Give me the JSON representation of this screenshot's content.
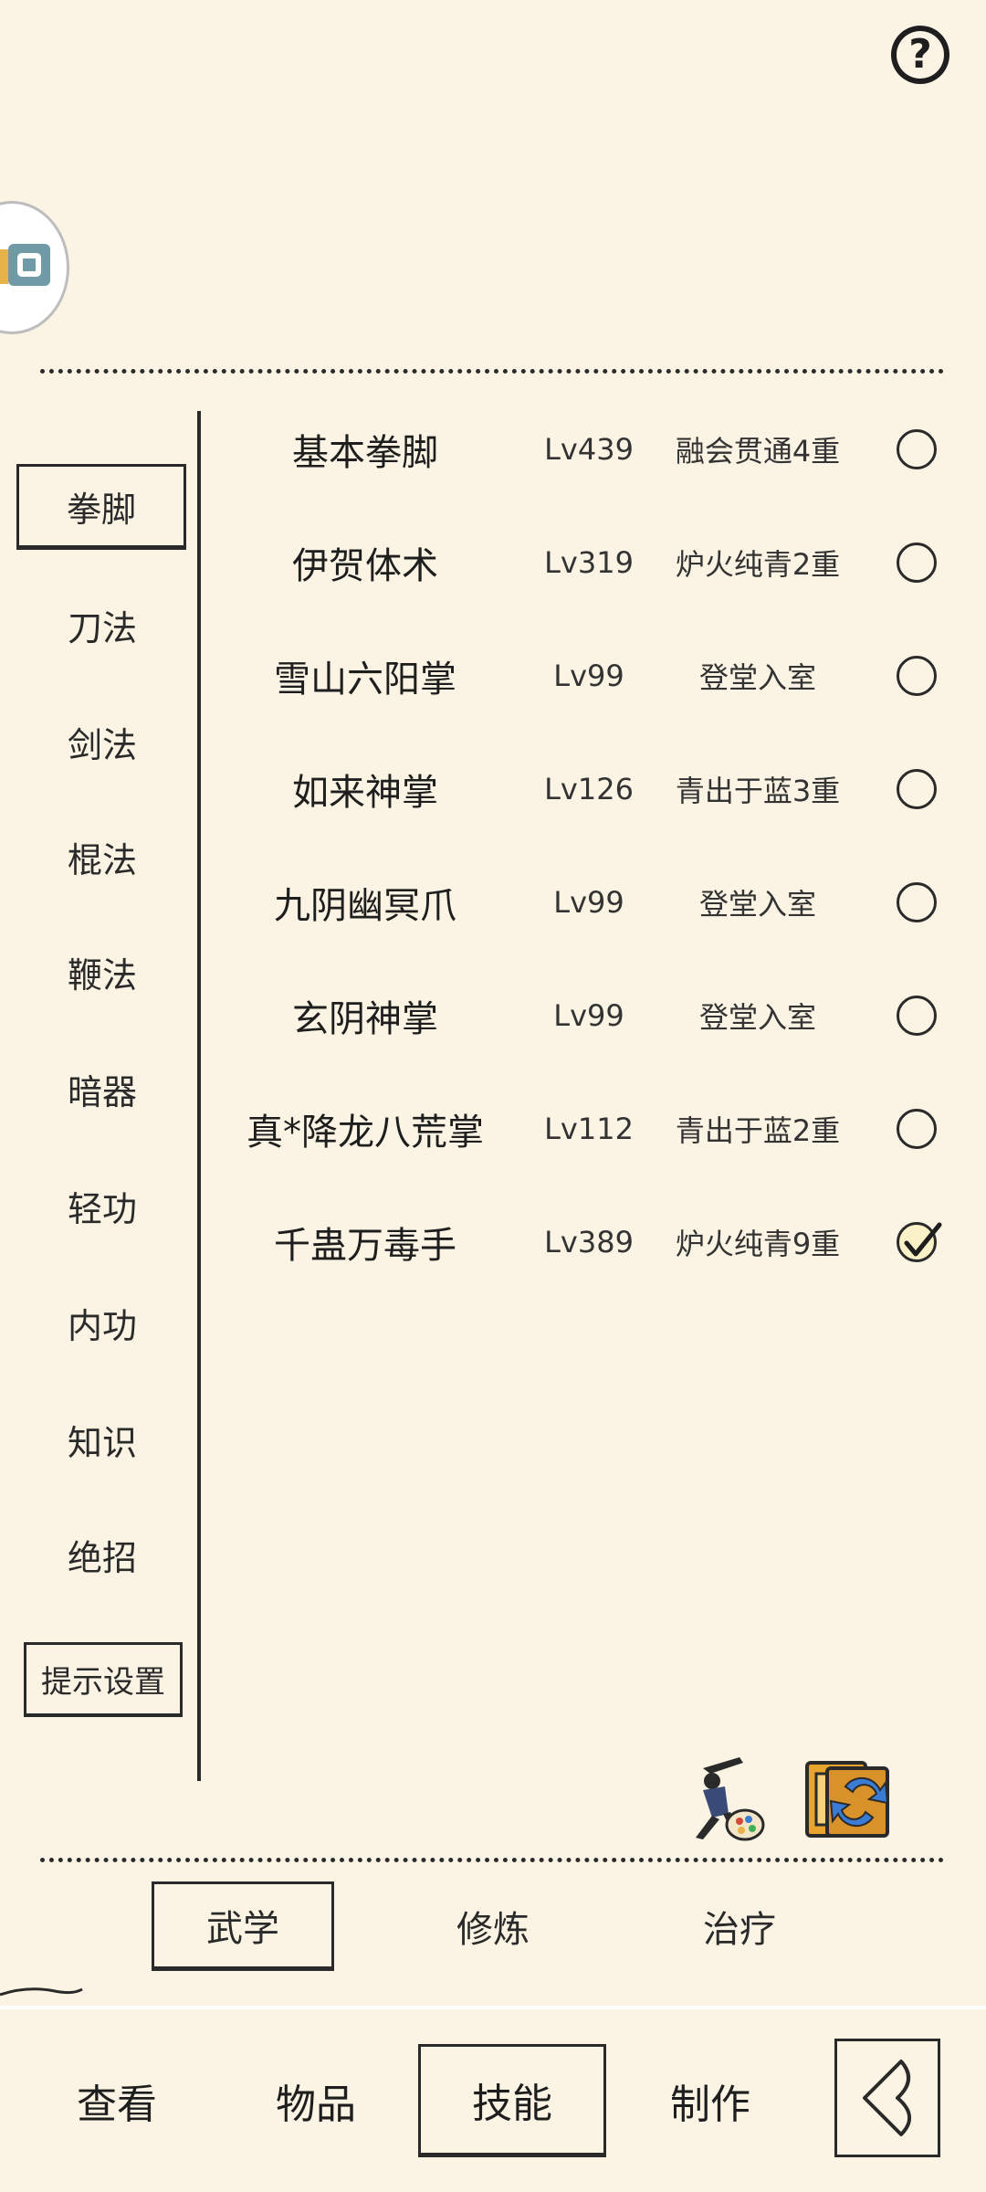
{
  "header": {
    "help_icon": "help-icon",
    "help_glyph": "?"
  },
  "categories": [
    {
      "label": "拳脚",
      "selected": true
    },
    {
      "label": "刀法"
    },
    {
      "label": "剑法"
    },
    {
      "label": "棍法"
    },
    {
      "label": "鞭法"
    },
    {
      "label": "暗器"
    },
    {
      "label": "轻功"
    },
    {
      "label": "内功"
    },
    {
      "label": "知识"
    },
    {
      "label": "绝招"
    }
  ],
  "hint_button": "提示设置",
  "skills": [
    {
      "name": "基本拳脚",
      "level": "Lv439",
      "state": "融会贯通4重",
      "checked": false
    },
    {
      "name": "伊贺体术",
      "level": "Lv319",
      "state": "炉火纯青2重",
      "checked": false
    },
    {
      "name": "雪山六阳掌",
      "level": "Lv99",
      "state": "登堂入室",
      "checked": false
    },
    {
      "name": "如来神掌",
      "level": "Lv126",
      "state": "青出于蓝3重",
      "checked": false
    },
    {
      "name": "九阴幽冥爪",
      "level": "Lv99",
      "state": "登堂入室",
      "checked": false
    },
    {
      "name": "玄阴神掌",
      "level": "Lv99",
      "state": "登堂入室",
      "checked": false
    },
    {
      "name": "真*降龙八荒掌",
      "level": "Lv112",
      "state": "青出于蓝2重",
      "checked": false
    },
    {
      "name": "千蛊万毒手",
      "level": "Lv389",
      "state": "炉火纯青9重",
      "checked": true
    }
  ],
  "action_icons": [
    "martial-artist-palette-icon",
    "scroll-exchange-icon"
  ],
  "sub_tabs": [
    {
      "label": "武学",
      "selected": true
    },
    {
      "label": "修炼"
    },
    {
      "label": "治疗"
    }
  ],
  "bottom_nav": [
    {
      "label": "查看"
    },
    {
      "label": "物品"
    },
    {
      "label": "技能",
      "selected": true
    },
    {
      "label": "制作"
    }
  ],
  "back_icon": "back-arrow-icon",
  "colors": {
    "background": "#fbf4e4",
    "ink": "#1e1e1e",
    "check_fill": "#fbf1c6"
  }
}
